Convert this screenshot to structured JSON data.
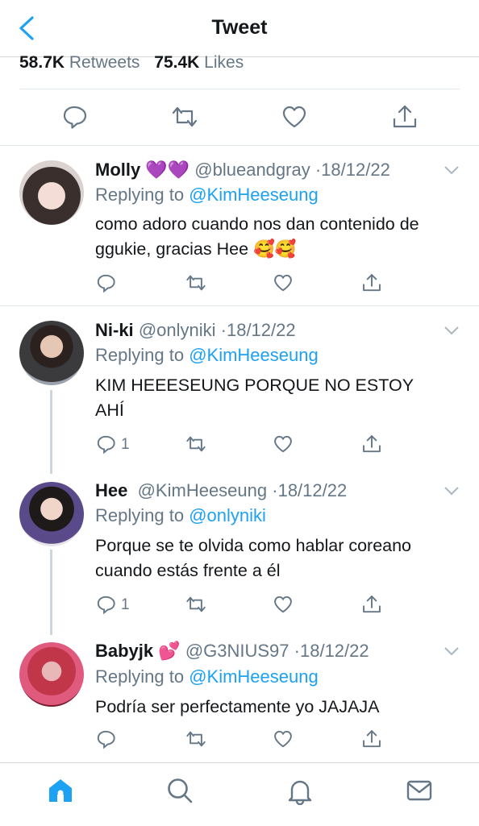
{
  "header": {
    "title": "Tweet",
    "back_icon": "chevron-left-icon"
  },
  "stats": {
    "retweets_count": "58.7K",
    "retweets_label": "Retweets",
    "likes_count": "75.4K",
    "likes_label": "Likes"
  },
  "main_actions": [
    "reply-icon",
    "retweet-icon",
    "like-icon",
    "share-icon"
  ],
  "colors": {
    "accent": "#1da1f2",
    "secondary_text": "#657786",
    "border": "#e1e8ed"
  },
  "replies": [
    {
      "name": "Molly",
      "name_emoji": "💜💜",
      "handle": "@blueandgray",
      "date": "18/12/22",
      "replying_label": "Replying to",
      "replying_to": "@KimHeeseung",
      "text": "como adoro cuando nos dan contenido de ggukie, gracias Hee 🥰🥰",
      "reply_count": ""
    },
    {
      "name": "Ni-ki",
      "name_emoji": "",
      "handle": "@onlyniki",
      "date": "18/12/22",
      "replying_label": "Replying to",
      "replying_to": "@KimHeeseung",
      "text": "KIM HEEESEUNG PORQUE NO ESTOY AHÍ",
      "reply_count": "1"
    },
    {
      "name": "Hee",
      "name_emoji": "",
      "handle": "@KimHeeseung",
      "date": "18/12/22",
      "replying_label": "Replying to",
      "replying_to": "@onlyniki",
      "text": "Porque se te olvida como hablar coreano cuando estás frente a él",
      "reply_count": "1"
    },
    {
      "name": "Babyjk",
      "name_emoji": "💕",
      "handle": "@G3NIUS97",
      "date": "18/12/22",
      "replying_label": "Replying to",
      "replying_to": "@KimHeeseung",
      "text": "Podría ser perfectamente yo JAJAJA",
      "reply_count": ""
    }
  ],
  "tabbar": [
    "home-icon",
    "search-icon",
    "notifications-icon",
    "messages-icon"
  ],
  "date_separator": "·"
}
